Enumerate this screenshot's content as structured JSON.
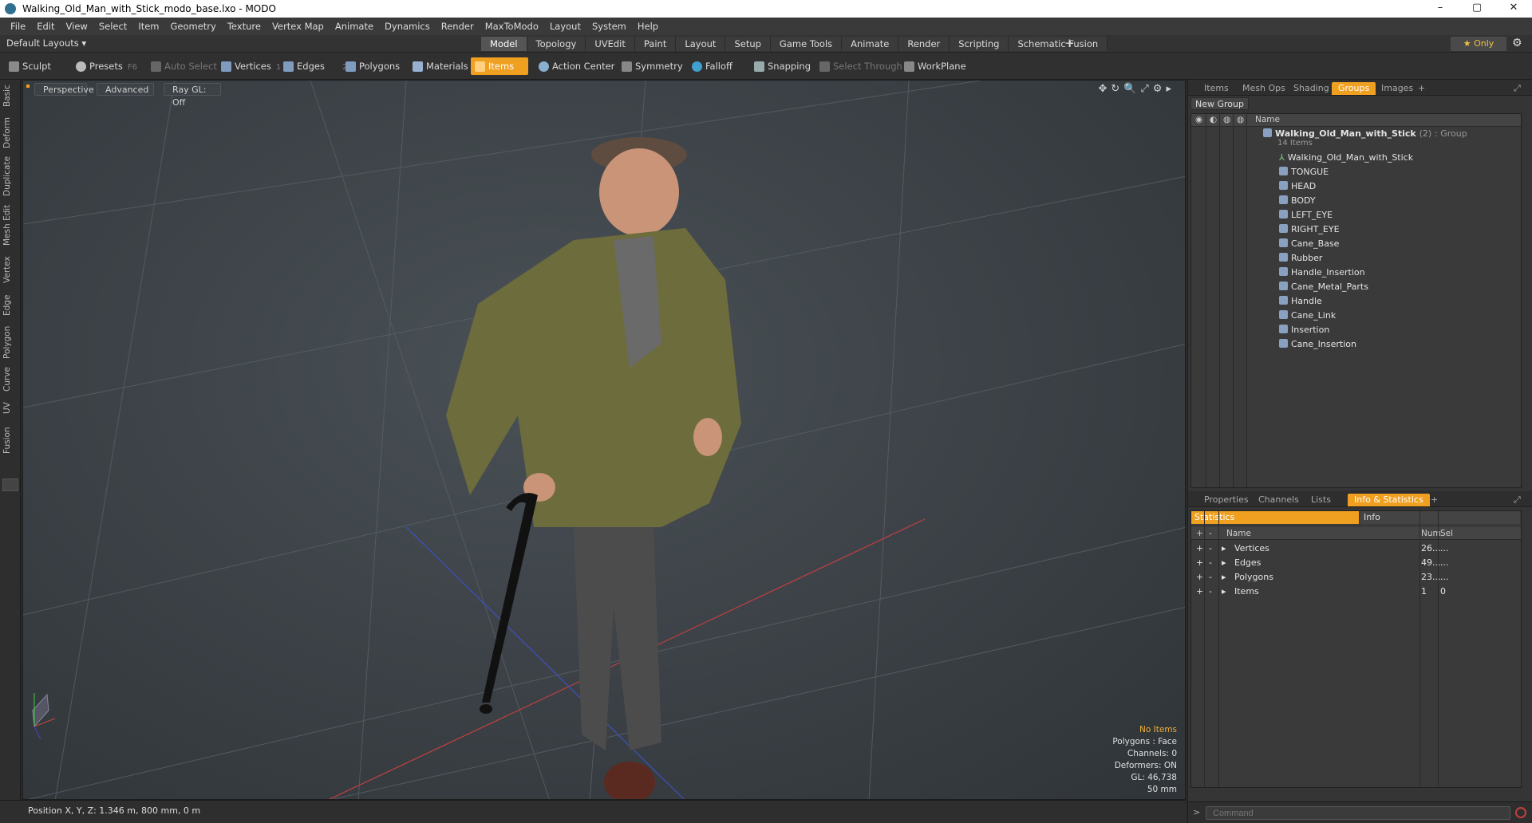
{
  "window": {
    "title": "Walking_Old_Man_with_Stick_modo_base.lxo - MODO",
    "controls": [
      "–",
      "▢",
      "✕"
    ]
  },
  "menu": [
    "File",
    "Edit",
    "View",
    "Select",
    "Item",
    "Geometry",
    "Texture",
    "Vertex Map",
    "Animate",
    "Dynamics",
    "Render",
    "MaxToModo",
    "Layout",
    "System",
    "Help"
  ],
  "layouts": {
    "label": "Default Layouts ▾",
    "tabs": [
      "Model",
      "Topology",
      "UVEdit",
      "Paint",
      "Layout",
      "Setup",
      "Game Tools",
      "Animate",
      "Render",
      "Scripting",
      "Schematic Fusion"
    ],
    "active": "Model",
    "only": "★ Only"
  },
  "toolbar": {
    "sculpt": "Sculpt",
    "presets": "Presets",
    "presets_key": "F6",
    "auto_select": "Auto Select",
    "vertices": "Vertices",
    "vertices_n": "1",
    "edges": "Edges",
    "edges_n": "2",
    "polygons": "Polygons",
    "materials": "Materials",
    "items": "Items",
    "action_center": "Action Center",
    "symmetry": "Symmetry",
    "falloff": "Falloff",
    "snapping": "Snapping",
    "select_through": "Select Through",
    "workplane": "WorkPlane"
  },
  "left_tabs": [
    "Basic",
    "Deform",
    "Duplicate",
    "Mesh Edit",
    "Vertex",
    "Edge",
    "Polygon",
    "Curve",
    "UV",
    "Fusion"
  ],
  "viewport": {
    "perspective": "Perspective",
    "advanced": "Advanced",
    "raygl": "Ray GL: Off",
    "info": [
      "No Items",
      "Polygons : Face",
      "Channels: 0",
      "Deformers: ON",
      "GL: 46,738",
      "50 mm"
    ]
  },
  "status": "Position X, Y, Z:   1.346 m, 800 mm, 0 m",
  "top_panel": {
    "tabs": [
      "Items",
      "Mesh Ops",
      "Shading",
      "Groups",
      "Images"
    ],
    "active": "Groups",
    "new_group": "New Group",
    "name_header": "Name",
    "group": {
      "name": "Walking_Old_Man_with_Stick",
      "count": "(2)",
      "kind": ": Group",
      "sub": "14 Items"
    },
    "items": [
      "Walking_Old_Man_with_Stick",
      "TONGUE",
      "HEAD",
      "BODY",
      "LEFT_EYE",
      "RIGHT_EYE",
      "Cane_Base",
      "Rubber",
      "Handle_Insertion",
      "Cane_Metal_Parts",
      "Handle",
      "Cane_Link",
      "Insertion",
      "Cane_Insertion"
    ]
  },
  "bottom_panel": {
    "tabs": [
      "Properties",
      "Channels",
      "Lists",
      "Info & Statistics"
    ],
    "active": "Info & Statistics",
    "statistics": "Statistics",
    "info": "Info",
    "headers": {
      "name": "Name",
      "num": "Num",
      "sel": "Sel"
    },
    "rows": [
      {
        "name": "Vertices",
        "num": "26...",
        "sel": "..."
      },
      {
        "name": "Edges",
        "num": "49...",
        "sel": "..."
      },
      {
        "name": "Polygons",
        "num": "23...",
        "sel": "..."
      },
      {
        "name": "Items",
        "num": "1",
        "sel": "0"
      }
    ]
  },
  "command": {
    "placeholder": "Command"
  }
}
